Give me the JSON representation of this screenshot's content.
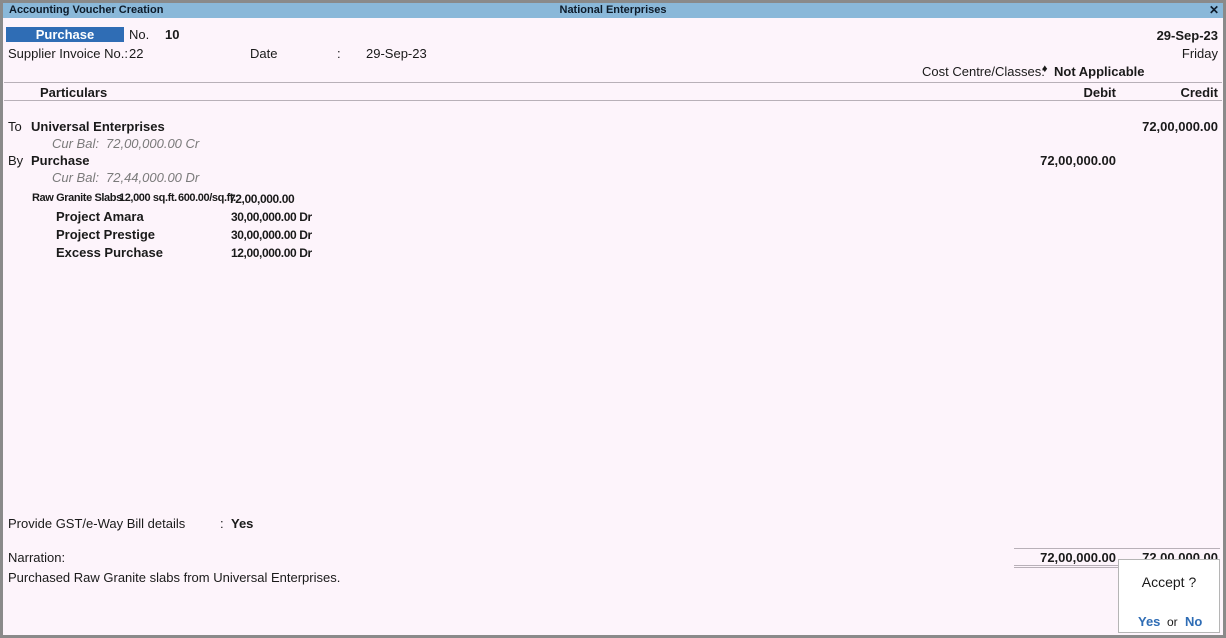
{
  "window": {
    "title": "Accounting Voucher Creation",
    "company": "National Enterprises",
    "close_glyph": "✕"
  },
  "voucher": {
    "type": "Purchase",
    "no_label": "No.",
    "no_value": "10",
    "date_top": "29-Sep-23",
    "day": "Friday",
    "supplier_invoice_label": "Supplier Invoice No.:",
    "supplier_invoice_value": "22",
    "date_label": "Date",
    "date_sep": ":",
    "date_value": "29-Sep-23",
    "cost_centre_label": "Cost Centre/Classes:",
    "cost_centre_bullet": "♦",
    "cost_centre_value": "Not Applicable"
  },
  "columns": {
    "particulars": "Particulars",
    "debit": "Debit",
    "credit": "Credit"
  },
  "entries": {
    "to": {
      "prefix": "To",
      "ledger": "Universal Enterprises",
      "credit": "72,00,000.00",
      "cur_bal_label": "Cur Bal:",
      "cur_bal_value": "72,00,000.00 Cr"
    },
    "by": {
      "prefix": "By",
      "ledger": "Purchase",
      "debit": "72,00,000.00",
      "cur_bal_label": "Cur Bal:",
      "cur_bal_value": "72,44,000.00 Dr"
    },
    "item": {
      "name": "Raw Granite Slabs",
      "qty": "12,000 sq.ft.",
      "rate": "600.00/sq.ft.",
      "amount": "72,00,000.00"
    },
    "cost_centres": [
      {
        "name": "Project Amara",
        "amount": "30,00,000.00 Dr"
      },
      {
        "name": "Project Prestige",
        "amount": "30,00,000.00 Dr"
      },
      {
        "name": "Excess Purchase",
        "amount": "12,00,000.00 Dr"
      }
    ]
  },
  "gst": {
    "label": "Provide GST/e-Way Bill details",
    "sep": ":",
    "value": "Yes"
  },
  "narration": {
    "label": "Narration:",
    "text": "Purchased Raw Granite slabs from Universal Enterprises.",
    "total_debit": "72,00,000.00",
    "total_credit": "72,00,000.00"
  },
  "accept_dialog": {
    "question": "Accept ?",
    "yes": "Yes",
    "or": "or",
    "no": "No"
  }
}
